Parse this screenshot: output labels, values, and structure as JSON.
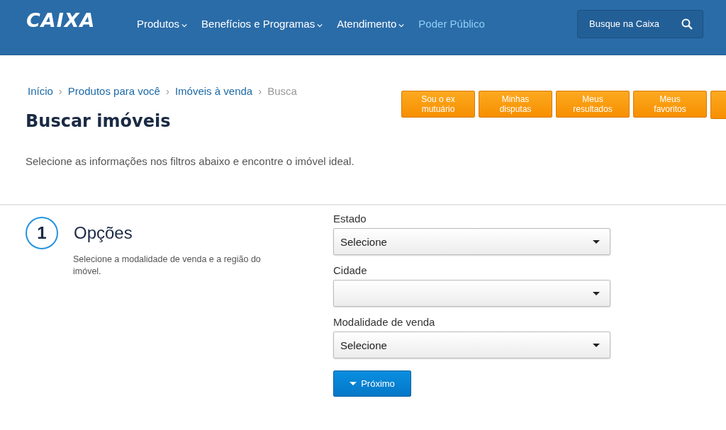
{
  "header": {
    "logo": "CAIXA",
    "nav": [
      {
        "label": "Produtos",
        "dropdown": true,
        "selected": false
      },
      {
        "label": "Benefícios e Programas",
        "dropdown": true,
        "selected": false
      },
      {
        "label": "Atendimento",
        "dropdown": true,
        "selected": false
      },
      {
        "label": "Poder Público",
        "dropdown": false,
        "selected": true
      }
    ],
    "search": {
      "placeholder": "Busque na Caixa"
    }
  },
  "breadcrumb": [
    {
      "label": "Início",
      "current": false
    },
    {
      "separator": "›",
      "label": "Produtos para você",
      "current": false
    },
    {
      "separator": "›",
      "label": "Imóveis à venda",
      "current": false
    },
    {
      "separator": "›",
      "label": "Busca",
      "current": true
    }
  ],
  "title": "Buscar imóveis",
  "actions": [
    "Sou o ex mutuário",
    "Minhas disputas",
    "Meus resultados",
    "Meus favoritos"
  ],
  "description": "Selecione as informações nos filtros abaixo e encontre o imóvel ideal.",
  "step": {
    "number": "1",
    "title": "Opções",
    "description": "Selecione a modalidade de venda e a região do imóvel."
  },
  "fields": [
    {
      "label": "Estado",
      "value": "Selecione"
    },
    {
      "label": "Cidade"
    },
    {
      "label": "Modalidade de venda",
      "value": "Selecione"
    }
  ],
  "next_button": "Próximo"
}
